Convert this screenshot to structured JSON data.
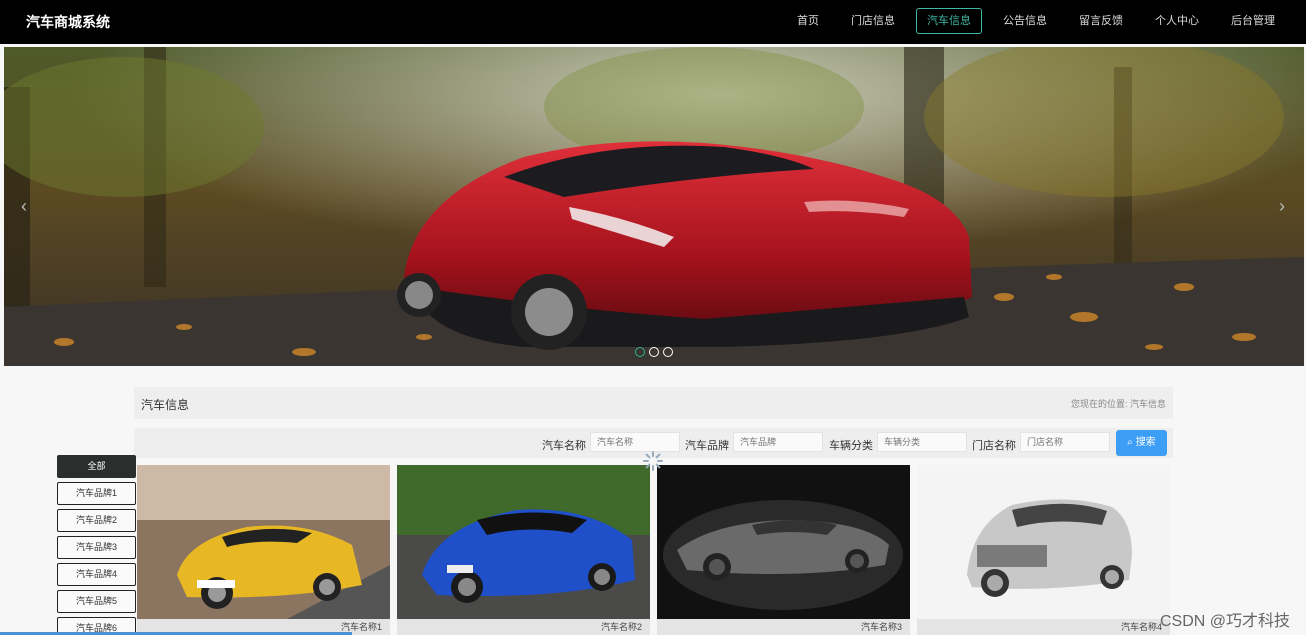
{
  "header": {
    "brand": "汽车商城系统",
    "nav": [
      "首页",
      "门店信息",
      "汽车信息",
      "公告信息",
      "留言反馈",
      "个人中心",
      "后台管理"
    ],
    "active_index": 2
  },
  "banner": {
    "slide_count": 3,
    "active_slide": 0
  },
  "section": {
    "title": "汽车信息",
    "breadcrumb_prefix": "您现在的位置:",
    "breadcrumb_current": "汽车信息"
  },
  "search": {
    "fields": [
      {
        "label": "汽车名称",
        "placeholder": "汽车名称"
      },
      {
        "label": "汽车品牌",
        "placeholder": "汽车品牌"
      },
      {
        "label": "车辆分类",
        "placeholder": "车辆分类"
      },
      {
        "label": "门店名称",
        "placeholder": "门店名称"
      }
    ],
    "button_label": "搜索"
  },
  "sidebar": {
    "items": [
      "全部",
      "汽车品牌1",
      "汽车品牌2",
      "汽车品牌3",
      "汽车品牌4",
      "汽车品牌5",
      "汽车品牌6"
    ]
  },
  "cards": [
    {
      "name": "汽车名称1"
    },
    {
      "name": "汽车名称2"
    },
    {
      "name": "汽车名称3"
    },
    {
      "name": "汽车名称4"
    }
  ],
  "watermark": "CSDN @巧才科技",
  "colors": {
    "accent": "#3fb8a4",
    "search_button": "#3d9ef5",
    "header_bg": "#000000"
  }
}
